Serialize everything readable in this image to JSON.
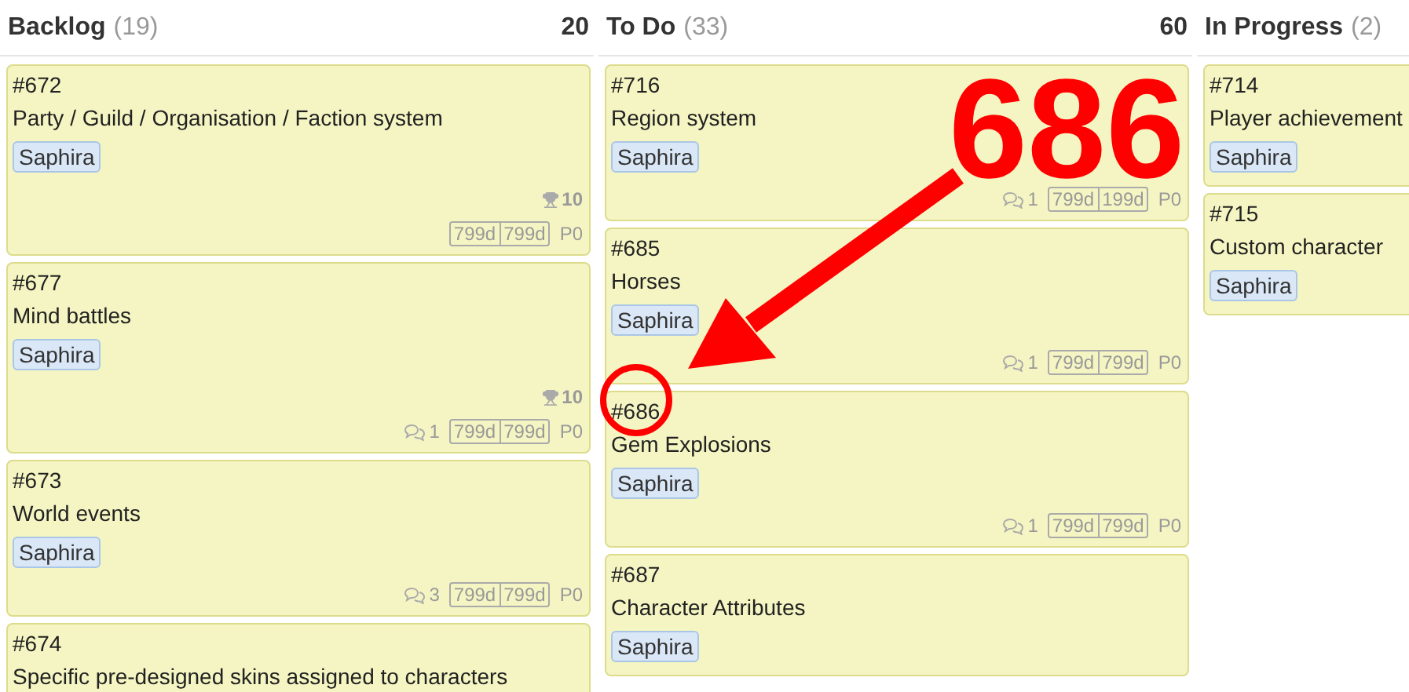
{
  "columns": [
    {
      "title": "Backlog",
      "count": "(19)",
      "total": "20",
      "cards": [
        {
          "id": "#672",
          "title": "Party / Guild / Organisation / Faction system",
          "tags": [
            "Saphira"
          ],
          "points": "10",
          "dates": [
            "799d",
            "799d"
          ],
          "priority": "P0"
        },
        {
          "id": "#677",
          "title": "Mind battles",
          "tags": [
            "Saphira"
          ],
          "points": "10",
          "comments": "1",
          "dates": [
            "799d",
            "799d"
          ],
          "priority": "P0"
        },
        {
          "id": "#673",
          "title": "World events",
          "tags": [
            "Saphira"
          ],
          "comments": "3",
          "dates": [
            "799d",
            "799d"
          ],
          "priority": "P0"
        },
        {
          "id": "#674",
          "title": "Specific pre-designed skins assigned to characters"
        }
      ]
    },
    {
      "title": "To Do",
      "count": "(33)",
      "total": "60",
      "cards": [
        {
          "id": "#716",
          "title": "Region system",
          "tags": [
            "Saphira"
          ],
          "comments": "1",
          "dates": [
            "799d",
            "199d"
          ],
          "priority": "P0"
        },
        {
          "id": "#685",
          "title": "Horses",
          "tags": [
            "Saphira"
          ],
          "comments": "1",
          "dates": [
            "799d",
            "799d"
          ],
          "priority": "P0"
        },
        {
          "id": "#686",
          "title": "Gem Explosions",
          "tags": [
            "Saphira"
          ],
          "comments": "1",
          "dates": [
            "799d",
            "799d"
          ],
          "priority": "P0"
        },
        {
          "id": "#687",
          "title": "Character Attributes",
          "tags": [
            "Saphira"
          ]
        }
      ]
    },
    {
      "title": "In Progress",
      "count": "(2)",
      "cards": [
        {
          "id": "#714",
          "title": "Player achievement",
          "tags": [
            "Saphira"
          ]
        },
        {
          "id": "#715",
          "title": "Custom character",
          "tags": [
            "Saphira"
          ]
        }
      ]
    }
  ],
  "annotation": {
    "label": "686"
  }
}
